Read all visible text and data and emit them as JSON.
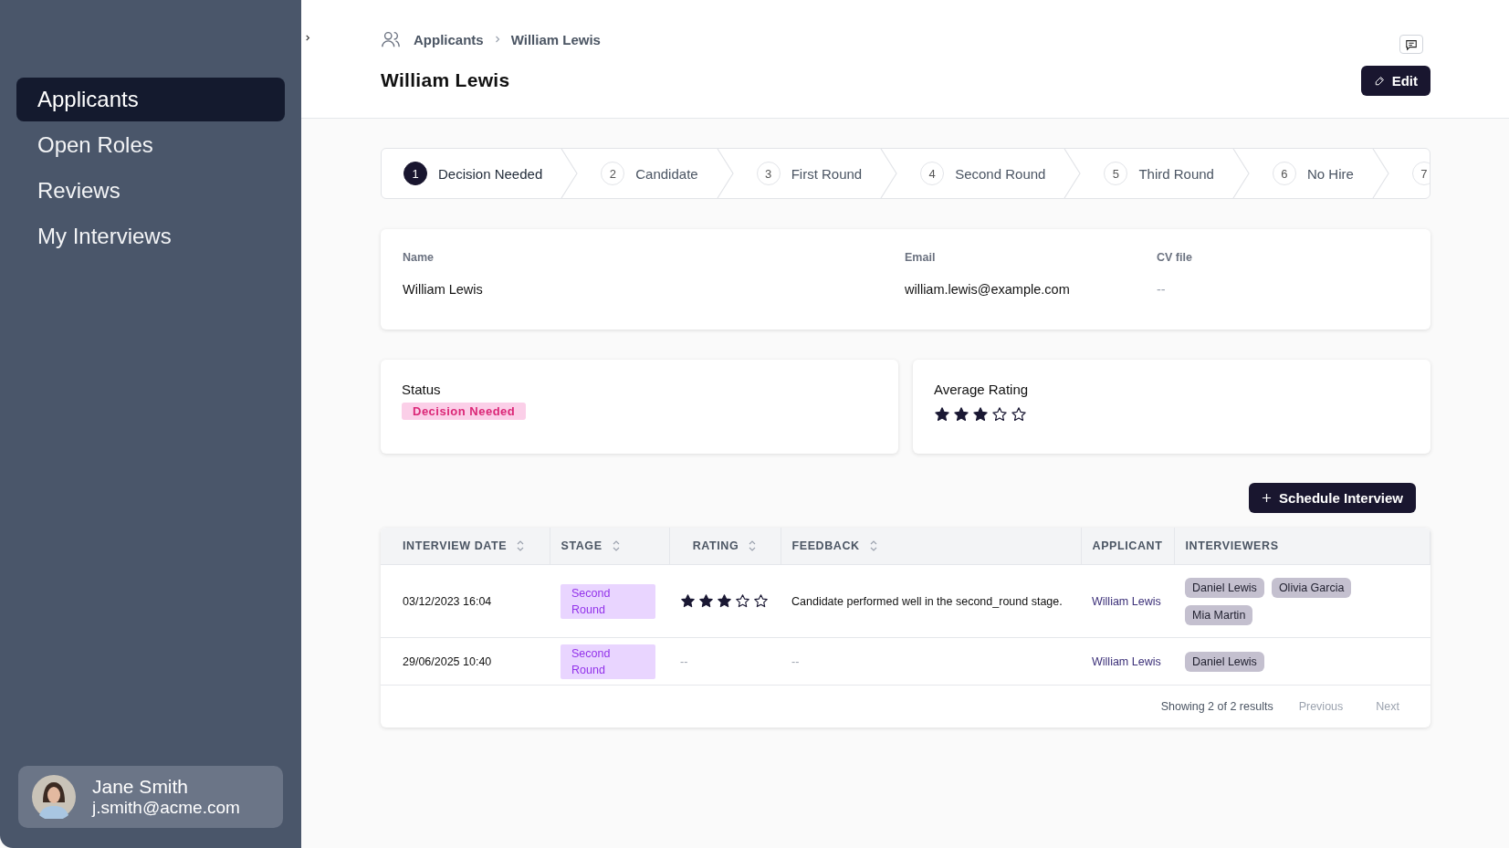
{
  "sidebar": {
    "items": [
      {
        "label": "Applicants",
        "selected": true
      },
      {
        "label": "Open Roles",
        "selected": false
      },
      {
        "label": "Reviews",
        "selected": false
      },
      {
        "label": "My Interviews",
        "selected": false
      }
    ],
    "user": {
      "name": "Jane Smith",
      "email": "j.smith@acme.com"
    }
  },
  "breadcrumb": [
    "Applicants",
    "William Lewis"
  ],
  "title": "William Lewis",
  "edit_button": "Edit",
  "steps": [
    {
      "number": "1",
      "label": "Decision Needed",
      "selected": true
    },
    {
      "number": "2",
      "label": "Candidate",
      "selected": false
    },
    {
      "number": "3",
      "label": "First Round",
      "selected": false
    },
    {
      "number": "4",
      "label": "Second Round",
      "selected": false
    },
    {
      "number": "5",
      "label": "Third Round",
      "selected": false
    },
    {
      "number": "6",
      "label": "No Hire",
      "selected": false
    },
    {
      "number": "7",
      "selected": false
    }
  ],
  "details": [
    {
      "label": "Name",
      "value": "William Lewis"
    },
    {
      "label": "Email",
      "value": "william.lewis@example.com"
    },
    {
      "label": "CV file",
      "value": "--"
    }
  ],
  "status": {
    "label": "Status",
    "badge": "Decision Needed"
  },
  "average_rating": {
    "label": "Average Rating",
    "stars": 3
  },
  "schedule_button": "Schedule Interview",
  "table": {
    "columns": [
      {
        "label": "INTERVIEW DATE",
        "sortable": true
      },
      {
        "label": "STAGE",
        "sortable": true
      },
      {
        "label": "RATING",
        "sortable": true
      },
      {
        "label": "FEEDBACK",
        "sortable": true
      },
      {
        "label": "APPLICANT",
        "sortable": false
      },
      {
        "label": "INTERVIEWERS",
        "sortable": false
      }
    ],
    "rows": [
      {
        "date": "03/12/2023 16:04",
        "stage": "Second Round",
        "stars": 3,
        "feedback": "Candidate performed well in the second_round stage.",
        "applicant": "William Lewis",
        "interviewers": [
          "Daniel Lewis",
          "Olivia Garcia",
          "Mia Martin"
        ]
      },
      {
        "date": "29/06/2025 10:40",
        "stage": "Second Round",
        "rating": "--",
        "feedback": "--",
        "applicant": "William Lewis",
        "interviewers": [
          "Daniel Lewis"
        ]
      }
    ]
  },
  "pagination": {
    "summary": "Showing 2 of 2 results",
    "previous": "Previous",
    "next": "Next"
  }
}
